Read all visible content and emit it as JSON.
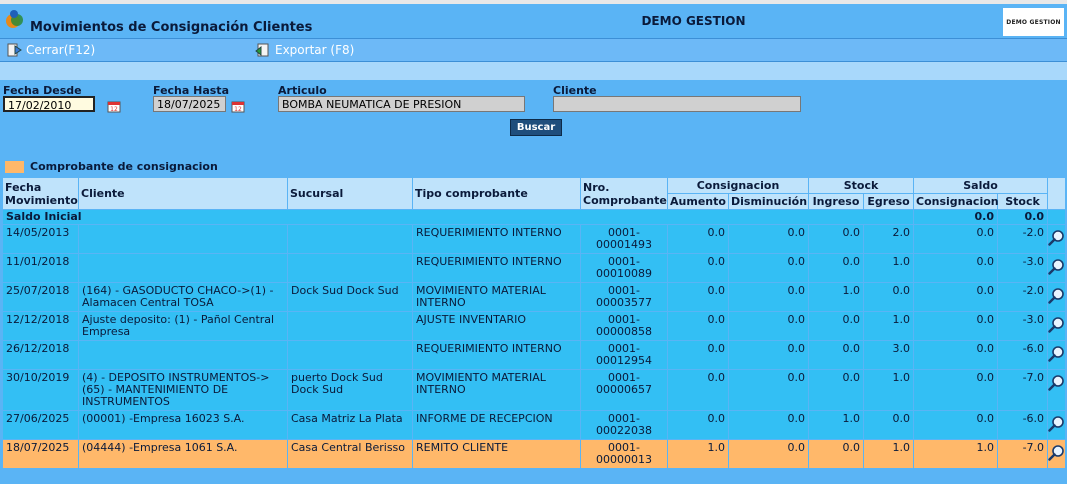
{
  "window": {
    "title": "Movimientos de Consignación Clientes",
    "company": "DEMO GESTION",
    "logo_text": "DEMO GESTION"
  },
  "toolbar": {
    "close_label": "Cerrar(F12)",
    "export_label": "Exportar (F8)"
  },
  "filters": {
    "date_from_label": "Fecha Desde",
    "date_from_value": "17/02/2010",
    "date_to_label": "Fecha Hasta",
    "date_to_value": "18/07/2025",
    "article_label": "Articulo",
    "article_value": "BOMBA NEUMATICA DE PRESION",
    "client_label": "Cliente",
    "client_value": "",
    "search_button": "Buscar"
  },
  "legend": {
    "label": "Comprobante de consignacion",
    "color": "#ffb86a"
  },
  "colors": {
    "header_bg": "#5ab4f5",
    "row_bg": "#33bff4",
    "highlight_bg": "#ffb86a",
    "button_bg": "#1f4e7c"
  },
  "table": {
    "headers": {
      "fecha": "Fecha Movimiento",
      "cliente": "Cliente",
      "sucursal": "Sucursal",
      "tipo": "Tipo comprobante",
      "nro": "Nro. Comprobante",
      "consignacion": "Consignacion",
      "stock": "Stock",
      "saldo": "Saldo",
      "aumento": "Aumento",
      "disminucion": "Disminución",
      "ingreso": "Ingreso",
      "egreso": "Egreso",
      "saldo_consignacion": "Consignacion",
      "saldo_stock": "Stock"
    },
    "saldo_inicial": {
      "label": "Saldo Inicial",
      "consignacion": "0.0",
      "stock": "0.0"
    },
    "rows": [
      {
        "fecha": "14/05/2013",
        "cliente": "",
        "sucursal": "",
        "tipo": "REQUERIMIENTO INTERNO",
        "nro": "0001-00001493",
        "aumento": "0.0",
        "disminucion": "0.0",
        "ingreso": "0.0",
        "egreso": "2.0",
        "saldo_consignacion": "0.0",
        "saldo_stock": "-2.0",
        "highlight": false
      },
      {
        "fecha": "11/01/2018",
        "cliente": "",
        "sucursal": "",
        "tipo": "REQUERIMIENTO INTERNO",
        "nro": "0001-00010089",
        "aumento": "0.0",
        "disminucion": "0.0",
        "ingreso": "0.0",
        "egreso": "1.0",
        "saldo_consignacion": "0.0",
        "saldo_stock": "-3.0",
        "highlight": false
      },
      {
        "fecha": "25/07/2018",
        "cliente": "(164) - GASODUCTO CHACO->(1) - Alamacen Central TOSA",
        "sucursal": "Dock Sud Dock Sud",
        "tipo": "MOVIMIENTO MATERIAL INTERNO",
        "nro": "0001-00003577",
        "aumento": "0.0",
        "disminucion": "0.0",
        "ingreso": "1.0",
        "egreso": "0.0",
        "saldo_consignacion": "0.0",
        "saldo_stock": "-2.0",
        "highlight": false
      },
      {
        "fecha": "12/12/2018",
        "cliente": "Ajuste deposito: (1) - Pañol Central Empresa",
        "sucursal": "",
        "tipo": "AJUSTE INVENTARIO",
        "nro": "0001-00000858",
        "aumento": "0.0",
        "disminucion": "0.0",
        "ingreso": "0.0",
        "egreso": "1.0",
        "saldo_consignacion": "0.0",
        "saldo_stock": "-3.0",
        "highlight": false
      },
      {
        "fecha": "26/12/2018",
        "cliente": "",
        "sucursal": "",
        "tipo": "REQUERIMIENTO INTERNO",
        "nro": "0001-00012954",
        "aumento": "0.0",
        "disminucion": "0.0",
        "ingreso": "0.0",
        "egreso": "3.0",
        "saldo_consignacion": "0.0",
        "saldo_stock": "-6.0",
        "highlight": false
      },
      {
        "fecha": "30/10/2019",
        "cliente": "(4) - DEPOSITO INSTRUMENTOS->(65) - MANTENIMIENTO DE INSTRUMENTOS",
        "sucursal": "puerto Dock Sud Dock Sud",
        "tipo": "MOVIMIENTO MATERIAL INTERNO",
        "nro": "0001-00000657",
        "aumento": "0.0",
        "disminucion": "0.0",
        "ingreso": "0.0",
        "egreso": "1.0",
        "saldo_consignacion": "0.0",
        "saldo_stock": "-7.0",
        "highlight": false
      },
      {
        "fecha": "27/06/2025",
        "cliente": "(00001) -Empresa 16023 S.A.",
        "sucursal": "Casa Matriz La Plata",
        "tipo": "INFORME DE RECEPCION",
        "nro": "0001-00022038",
        "aumento": "0.0",
        "disminucion": "0.0",
        "ingreso": "1.0",
        "egreso": "0.0",
        "saldo_consignacion": "0.0",
        "saldo_stock": "-6.0",
        "highlight": false
      },
      {
        "fecha": "18/07/2025",
        "cliente": "(04444) -Empresa 1061 S.A.",
        "sucursal": "Casa Central Berisso",
        "tipo": "REMITO CLIENTE",
        "nro": "0001-00000013",
        "aumento": "1.0",
        "disminucion": "0.0",
        "ingreso": "0.0",
        "egreso": "1.0",
        "saldo_consignacion": "1.0",
        "saldo_stock": "-7.0",
        "highlight": true
      }
    ]
  }
}
